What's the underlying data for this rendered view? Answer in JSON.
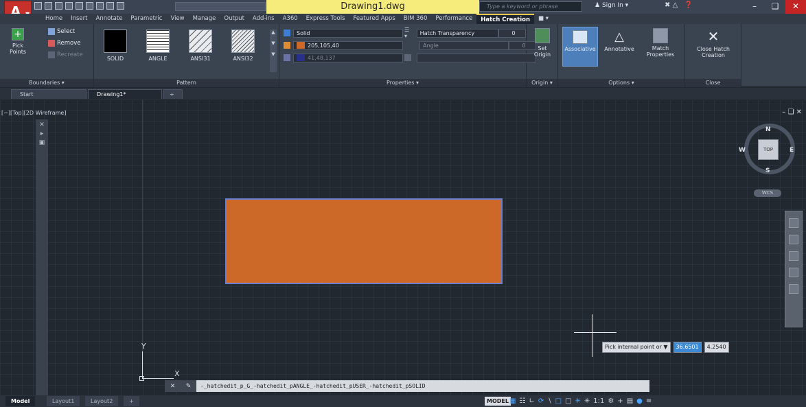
{
  "window": {
    "title": "Drawing1.dwg",
    "search_placeholder": "Type a keyword or phrase",
    "sign_in": "Sign In"
  },
  "menu_tabs": [
    "Home",
    "Insert",
    "Annotate",
    "Parametric",
    "View",
    "Manage",
    "Output",
    "Add-ins",
    "A360",
    "Express Tools",
    "Featured Apps",
    "BIM 360",
    "Performance",
    "Hatch Creation"
  ],
  "active_tab": "Hatch Creation",
  "ribbon": {
    "boundaries": {
      "title": "Boundaries",
      "pick_points": "Pick Points",
      "select": "Select",
      "remove": "Remove",
      "recreate": "Recreate"
    },
    "pattern": {
      "title": "Pattern",
      "items": [
        "SOLID",
        "ANGLE",
        "ANSI31",
        "ANSI32"
      ]
    },
    "properties": {
      "title": "Properties",
      "hatch_type": "Solid",
      "color": "205,105,40",
      "color_hex": "#cd6928",
      "bg_color": "41,48,137",
      "bg_hex": "#29308a",
      "transparency_label": "Hatch Transparency",
      "transparency_value": "0",
      "angle_label": "Angle",
      "angle_value": "0"
    },
    "origin": {
      "title": "Origin",
      "set_origin": "Set Origin"
    },
    "options": {
      "title": "Options",
      "associative": "Associative",
      "annotative": "Annotative",
      "match_properties": "Match Properties"
    },
    "close": {
      "title": "Close",
      "close_hatch": "Close Hatch Creation"
    }
  },
  "file_tabs": [
    "Start",
    "Drawing1*"
  ],
  "viewport": {
    "label": "[−][Top][2D Wireframe]"
  },
  "viewcube": {
    "face": "TOP",
    "north": "N",
    "south": "S",
    "east": "E",
    "west": "W",
    "wcs": "WCS"
  },
  "ucs": {
    "y": "Y",
    "x": "X"
  },
  "prompt": {
    "label": "Pick internal point or",
    "x_value": "36.6501",
    "y_value": "4.2540"
  },
  "command_line": "-_hatchedit_p_G_-hatchedit_pANGLE_-hatchedit_pUSER_-hatchedit_pSOLID",
  "layout_tabs": [
    "Model",
    "Layout1",
    "Layout2"
  ],
  "status": {
    "model": "MODEL",
    "scale": "1:1"
  }
}
